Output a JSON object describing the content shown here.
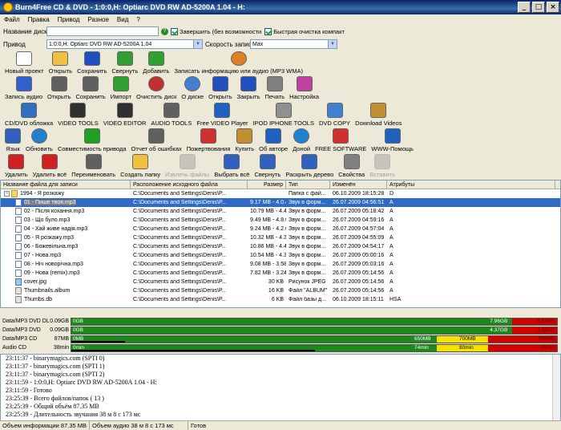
{
  "window": {
    "title": "Burn4Free CD & DVD - 1:0:0,H: Optiarc DVD RW AD-5200A 1.04 - H:"
  },
  "menu": [
    "Файл",
    "Правка",
    "Привод",
    "Разное",
    "Вид",
    "?"
  ],
  "form": {
    "disk_name_label": "Название диска",
    "disk_name_value": "",
    "finalize_label": "Завершить (без возможности",
    "finalize_checked": true,
    "quick_erase_label": "Быстрая очистка компакт",
    "quick_erase_checked": true,
    "drive_label": "Привод",
    "drive_value": "1:0:0,H: Optiarc DVD RW AD-5200A 1.04",
    "speed_label": "Скорость записи",
    "speed_value": "Max"
  },
  "toolbar1": [
    {
      "label": "Новый проект",
      "icon": "new-page-icon",
      "color": "#ffffff"
    },
    {
      "label": "Открыть",
      "icon": "open-folder-icon",
      "color": "#f0c040"
    },
    {
      "label": "Сохранить",
      "icon": "floppy-icon",
      "color": "#2050c0"
    },
    {
      "label": "Свернуть",
      "icon": "minimize-icon",
      "color": "#30a030"
    },
    {
      "label": "Добавить",
      "icon": "add-icon",
      "color": "#30a030"
    },
    {
      "label": "Записать информацию или аудио (MP3 WMA)",
      "icon": "burn-disc-icon",
      "color": "#e08020"
    }
  ],
  "toolbar2": [
    {
      "label": "Запись аудио",
      "icon": "music-note-icon",
      "color": "#3060d0"
    },
    {
      "label": "Открыть",
      "icon": "iso-icon",
      "color": "#606060"
    },
    {
      "label": "Сохранить",
      "icon": "iso-save-icon",
      "color": "#606060"
    },
    {
      "label": "Импорт",
      "icon": "import-icon",
      "color": "#30a030"
    },
    {
      "label": "Очистить диск",
      "icon": "erase-disc-icon",
      "color": "#c03030"
    },
    {
      "label": "О диске",
      "icon": "disc-info-icon",
      "color": "#4080d0"
    },
    {
      "label": "Открыть",
      "icon": "eject-icon",
      "color": "#2050c0"
    },
    {
      "label": "Закрыть",
      "icon": "close-tray-icon",
      "color": "#2050c0"
    },
    {
      "label": "Печать",
      "icon": "printer-icon",
      "color": "#808080"
    },
    {
      "label": "Настройка",
      "icon": "settings-icon",
      "color": "#c040a0"
    }
  ],
  "toolbar3": [
    {
      "label": "CD/DVD обложка",
      "icon": "cover-icon",
      "color": "#3070c0"
    },
    {
      "label": "VIDEO TOOLS",
      "icon": "film-icon",
      "color": "#303030"
    },
    {
      "label": "VIDEO EDITOR",
      "icon": "film-edit-icon",
      "color": "#303030"
    },
    {
      "label": "AUDIO TOOLS",
      "icon": "audio-tools-icon",
      "color": "#606060"
    },
    {
      "label": "Free VIDEO Player",
      "icon": "player-icon",
      "color": "#2060c0"
    },
    {
      "label": "IPOD IPHONE TOOLS",
      "icon": "ipod-icon",
      "color": "#909090"
    },
    {
      "label": "DVD COPY",
      "icon": "dvd-copy-icon",
      "color": "#4080d0"
    },
    {
      "label": "Download Videos",
      "icon": "download-icon",
      "color": "#c09030"
    }
  ],
  "toolbar4": [
    {
      "label": "Язык",
      "icon": "flag-icon",
      "color": "#3060c0"
    },
    {
      "label": "Обновить",
      "icon": "globe-icon",
      "color": "#2080d0"
    },
    {
      "label": "Совместимость привода",
      "icon": "check-icon",
      "color": "#20a020"
    },
    {
      "label": "Отчет об ошибках",
      "icon": "bug-icon",
      "color": "#606060"
    },
    {
      "label": "Пожертвования",
      "icon": "donate-icon",
      "color": "#d03030"
    },
    {
      "label": "Купить",
      "icon": "cart-icon",
      "color": "#c09030"
    },
    {
      "label": "Об авторе",
      "icon": "help-icon",
      "color": "#2060c0"
    },
    {
      "label": "Доной",
      "icon": "home-globe-icon",
      "color": "#2080d0"
    },
    {
      "label": "FREE SOFTWARE",
      "icon": "free-icon",
      "color": "#d03030"
    },
    {
      "label": "WWW-Помощь",
      "icon": "web-help-icon",
      "color": "#2060c0"
    }
  ],
  "toolbar5": [
    {
      "label": "Удалить",
      "icon": "delete-icon",
      "color": "#d02020",
      "disabled": false
    },
    {
      "label": "Удалить всё",
      "icon": "delete-all-icon",
      "color": "#d02020",
      "disabled": false
    },
    {
      "label": "Переименовать",
      "icon": "rename-icon",
      "color": "#606060",
      "disabled": false
    },
    {
      "label": "Создать папку",
      "icon": "new-folder-icon",
      "color": "#f0c040",
      "disabled": false
    },
    {
      "label": "Извлечь файлы",
      "icon": "extract-icon",
      "color": "#808080",
      "disabled": true
    },
    {
      "label": "Выбрать всё",
      "icon": "select-all-icon",
      "color": "#3060c0",
      "disabled": false
    },
    {
      "label": "Свернуть",
      "icon": "collapse-icon",
      "color": "#3060c0",
      "disabled": false
    },
    {
      "label": "Раскрыть дерево",
      "icon": "expand-tree-icon",
      "color": "#3060c0",
      "disabled": false
    },
    {
      "label": "Свойства",
      "icon": "properties-icon",
      "color": "#808080",
      "disabled": false
    },
    {
      "label": "Вставить",
      "icon": "paste-icon",
      "color": "#808080",
      "disabled": true
    }
  ],
  "grid": {
    "columns": [
      "Название файла для записи",
      "Расположение исходного файла",
      "Размер",
      "Тип",
      "Изменён",
      "Атрибуты"
    ],
    "rows": [
      {
        "name": "1994 - Я розкажу",
        "path": "C:\\Documents and Settings\\Denis\\Р...",
        "size": "",
        "type": "Папка с фай...",
        "modified": "06.10.2009 18:15:28",
        "attr": "D",
        "kind": "folder",
        "indent": 0,
        "selected": false
      },
      {
        "name": "01 - Пише твоя.mp3",
        "path": "C:\\Documents and Settings\\Denis\\Р...",
        "size": "9.17 MB - 4.0.413",
        "type": "Звук в форм...",
        "modified": "26.07.2009 04:56:51",
        "attr": "A",
        "kind": "mp3",
        "indent": 1,
        "selected": true
      },
      {
        "name": "02 - Після кохання.mp3",
        "path": "C:\\Documents and Settings\\Denis\\Р...",
        "size": "10.79 MB - 4.42.867",
        "type": "Звук в форм...",
        "modified": "26.07.2009 05:18:42",
        "attr": "A",
        "kind": "mp3",
        "indent": 1,
        "selected": false
      },
      {
        "name": "03 - Що було.mp3",
        "path": "C:\\Documents and Settings\\Denis\\Р...",
        "size": "9.49 MB - 4.8.600",
        "type": "Звук в форм...",
        "modified": "26.07.2009 04:59:16",
        "attr": "A",
        "kind": "mp3",
        "indent": 1,
        "selected": false
      },
      {
        "name": "04 - Хай живе надія.mp3",
        "path": "C:\\Documents and Settings\\Denis\\Р...",
        "size": "9.24 MB - 4.2.67",
        "type": "Звук в форм...",
        "modified": "26.07.2009 04:57:04",
        "attr": "A",
        "kind": "mp3",
        "indent": 1,
        "selected": false
      },
      {
        "name": "05 - Я розкажу.mp3",
        "path": "C:\\Documents and Settings\\Denis\\Р...",
        "size": "10.32 MB - 4.30.493",
        "type": "Звук в форм...",
        "modified": "26.07.2009 04:55:09",
        "attr": "A",
        "kind": "mp3",
        "indent": 1,
        "selected": false
      },
      {
        "name": "06 - Божевільна.mp3",
        "path": "C:\\Documents and Settings\\Denis\\Р...",
        "size": "10.86 MB - 4.44.707",
        "type": "Звук в форм...",
        "modified": "26.07.2009 04:54:17",
        "attr": "A",
        "kind": "mp3",
        "indent": 1,
        "selected": false
      },
      {
        "name": "07 - Нова.mp3",
        "path": "C:\\Documents and Settings\\Denis\\Р...",
        "size": "10.54 MB - 4.36.147",
        "type": "Звук в форм...",
        "modified": "26.07.2009 05:00:16",
        "attr": "A",
        "kind": "mp3",
        "indent": 1,
        "selected": false
      },
      {
        "name": "08 - Ніч новорічна.mp3",
        "path": "C:\\Documents and Settings\\Denis\\Р...",
        "size": "9.08 MB - 3.58.40",
        "type": "Звук в форм...",
        "modified": "26.07.2009 05:03:16",
        "attr": "A",
        "kind": "mp3",
        "indent": 1,
        "selected": false
      },
      {
        "name": "09 - Нова (remix).mp3",
        "path": "C:\\Documents and Settings\\Denis\\Р...",
        "size": "7.82 MB - 3.24.840",
        "type": "Звук в форм...",
        "modified": "26.07.2009 05:14:56",
        "attr": "A",
        "kind": "mp3",
        "indent": 1,
        "selected": false
      },
      {
        "name": "cover.jpg",
        "path": "C:\\Documents and Settings\\Denis\\Р...",
        "size": "30 KB",
        "type": "Рисунок JPEG",
        "modified": "26.07.2009 05:14:56",
        "attr": "A",
        "kind": "img",
        "indent": 1,
        "selected": false
      },
      {
        "name": "Thumbnails.album",
        "path": "C:\\Documents and Settings\\Denis\\Р...",
        "size": "16 KB",
        "type": "Файл \"ALBUM\"",
        "modified": "26.07.2009 05:14:56",
        "attr": "A",
        "kind": "db",
        "indent": 1,
        "selected": false
      },
      {
        "name": "Thumbs.db",
        "path": "C:\\Documents and Settings\\Denis\\Р...",
        "size": "6 KB",
        "type": "Файл базы д...",
        "modified": "06.10.2009 18:15:11",
        "attr": "HSA",
        "kind": "db",
        "indent": 1,
        "selected": false
      }
    ]
  },
  "disks": [
    {
      "label": "Data/MP3 DVD DL",
      "used": "0.09GB",
      "start_text": "0GB",
      "free_text": "7.96GB",
      "remain_text": "8.53GB",
      "green": 0.905,
      "yellow_from": 0,
      "yellow_to": 0,
      "black": 0
    },
    {
      "label": "Data/MP3 DVD",
      "used": "0.09GB",
      "start_text": "0GB",
      "free_text": "4.37GB",
      "remain_text": "4.35GB",
      "green": 0.905,
      "yellow_from": 0,
      "yellow_to": 0,
      "black": 0
    },
    {
      "label": "Data/MP3 CD",
      "used": "87MB",
      "start_text": "0MB",
      "free_text": "650MB",
      "remain_text": "789MB",
      "green": 0.75,
      "yellow_from": 0.75,
      "yellow_to": 0.855,
      "black": 0.11
    },
    {
      "label": "Audio CD",
      "used": "38min",
      "start_text": "0min",
      "free_text": "74min",
      "remain_text": "90min",
      "green": 0.75,
      "yellow_from": 0.75,
      "yellow_to": 0.855,
      "black": 0.5
    }
  ],
  "log": [
    "23:11:37 - binarymagics.com (SPTI 0)",
    "23:11:37 - binarymagics.com (SPTI 1)",
    "23:11:37 - binarymagics.com (SPTI 2)",
    "23:11:59 - 1:0:0,H: Optiarc DVD RW AD-5200A 1.04 - H:",
    "23:11:59 - Готово",
    "23:25:39 - Всего файлов/папок ( 13 )",
    "23:25:39 - Общий объём 87.35 MB",
    "23:25:39 - Длительность звучания 38 м 8 с 173 мс"
  ],
  "extra_disk_texts": {
    "cd_mid": "700MB",
    "audio_mid": "80min"
  },
  "status": {
    "info": "Объем информации 87.35 MB",
    "audio": "Объем аудио 38 м 8 с 173 мс",
    "state": "Готов"
  }
}
